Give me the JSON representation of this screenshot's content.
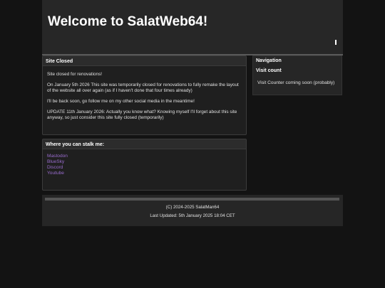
{
  "header": {
    "title": "Welcome to SalatWeb64!"
  },
  "site_closed": {
    "heading": "Site Closed",
    "paragraphs": [
      "Site closed for renovations!",
      "On January 5th 2026 This site was temporarily closed for renovations to fully remake the layout of the website all over again (as if I haven't done that four times already)",
      "I'll be back soon, go follow me on my other social media in the meantime!",
      "UPDATE 11th January 2026: Actually you know what? Knowing myself I'll forget about this site anyway, so just consider this site fully closed (temporarily)"
    ]
  },
  "stalk": {
    "heading": "Where you can stalk me:",
    "links": [
      "Mastodon",
      "BlueSky",
      "Discord",
      "Youtube"
    ]
  },
  "sidebar": {
    "navigation_heading": "Navigation",
    "visit_count_heading": "Visit count",
    "visit_count_text": "Visit Counter coming soon (probably)"
  },
  "footer": {
    "copyright": "(C) 2024-2025 SalatMan64",
    "last_updated": "Last Updated: 5th January 2025 18:04 CET"
  },
  "colors": {
    "background": "#131313",
    "panel": "#1f1f1f",
    "link": "#9a6ccf"
  }
}
